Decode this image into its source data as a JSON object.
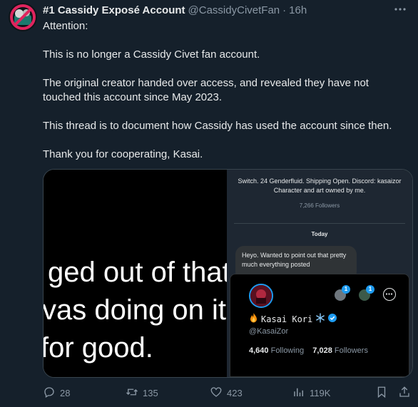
{
  "tweet": {
    "author_name": "#1 Cassidy Exposé Account",
    "handle": "@CassidyCivetFan",
    "separator": "·",
    "time": "16h",
    "paragraphs": [
      "Attention:",
      "This is no longer a Cassidy Civet fan account.",
      "The original creator handed over access, and revealed they have not touched this account since May 2023.",
      "This thread is to document how Cassidy has used the account since then.",
      "Thank you for cooperating, Kasai."
    ]
  },
  "media": {
    "left_lines": [
      "ged out of that a",
      "vas doing on it a",
      " for good."
    ],
    "bio": "Switch. 24 Genderfluid. Shipping Open. Discord: kasaizor Character and art owned by me.",
    "followers_line": "7,266 Followers",
    "today_label": "Today",
    "dm_text": "Heyo. Wanted to point out that pretty much everything posted",
    "card": {
      "name": "Kasai Kori",
      "handle": "@KasaiZor",
      "following_count": "4,640",
      "following_label": "Following",
      "followers_count": "7,028",
      "followers_label": "Followers",
      "badge_1": "1",
      "badge_2": "1"
    }
  },
  "actions": {
    "replies": "28",
    "retweets": "135",
    "likes": "423",
    "views": "119K"
  },
  "colors": {
    "background": "#15202b",
    "text": "#e7e9ea",
    "muted": "#8b98a5",
    "accent": "#1d9bf0"
  }
}
